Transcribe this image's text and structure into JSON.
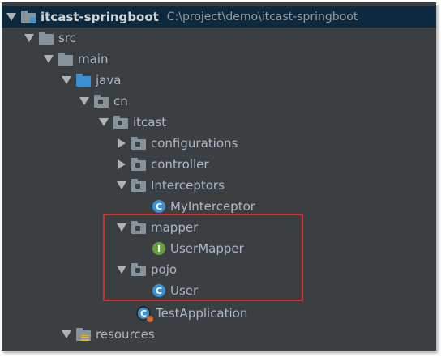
{
  "tree": {
    "root": {
      "label": "itcast-springboot",
      "path": "C:\\project\\demo\\itcast-springboot"
    },
    "src": "src",
    "main": "main",
    "java": "java",
    "cn": "cn",
    "itcast": "itcast",
    "configurations": "configurations",
    "controller": "controller",
    "interceptors": "Interceptors",
    "my_interceptor": "MyInterceptor",
    "mapper": "mapper",
    "user_mapper": "UserMapper",
    "pojo": "pojo",
    "user": "User",
    "test_application": "TestApplication",
    "resources": "resources",
    "icons": {
      "class": "C",
      "interface": "I"
    }
  },
  "colors": {
    "panel_bg": "#3c3f41",
    "selected_row_bg": "#0d293e",
    "text": "#a9b7c6",
    "highlight_border": "#d62c2c",
    "class_icon": "#3d8fd1",
    "interface_icon": "#62a03d"
  }
}
